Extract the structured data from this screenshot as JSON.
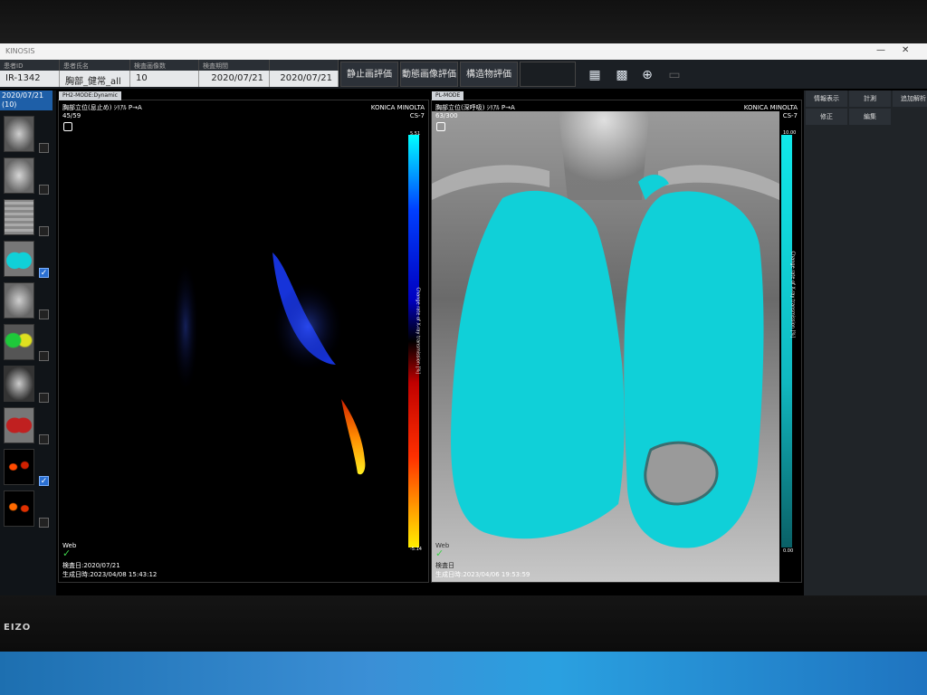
{
  "window": {
    "title": "KINOSIS"
  },
  "header": {
    "fields": [
      {
        "label": "患者ID",
        "value": "IR-1342"
      },
      {
        "label": "患者氏名",
        "value": "胸部_健常_all"
      },
      {
        "label": "検査画像数",
        "value": "10"
      },
      {
        "label": "検査期間",
        "value": "2020/07/21"
      },
      {
        "label": "",
        "value": "2020/07/21"
      }
    ],
    "buttons": [
      "静止画評価",
      "動態画像評価",
      "構造物評価"
    ],
    "icons": [
      "grid-all-icon",
      "grid-settings-icon",
      "zoom-add-icon",
      "film-icon"
    ]
  },
  "thumbnails": {
    "date": "2020/07/21",
    "count": "(10)",
    "items": [
      {
        "type": "xray",
        "checked": false
      },
      {
        "type": "xray",
        "checked": false
      },
      {
        "type": "xray",
        "checked": false
      },
      {
        "type": "cyan-overlay",
        "checked": true
      },
      {
        "type": "xray",
        "checked": false
      },
      {
        "type": "green-overlay",
        "checked": false
      },
      {
        "type": "xray",
        "checked": false
      },
      {
        "type": "red-overlay",
        "checked": false
      },
      {
        "type": "heat-dark",
        "checked": true
      },
      {
        "type": "heat-dark",
        "checked": false
      }
    ]
  },
  "left_viewer": {
    "tab": "PH2-MODE:Dynamic",
    "title": "胸部立位(息止め) ｼﾘｱﾙ P→A",
    "frame": "45/59",
    "maker": "KONICA MINOLTA",
    "model": "CS-7",
    "scale_top": "5.51",
    "scale_bottom": "-5.14",
    "axis_label": "Change rate of X-ray transmission [%]",
    "source": "Web",
    "exam_date": "検査日:2020/07/21",
    "created": "生成日時:2023/04/08 15:43:12",
    "colors": {
      "low": "#ffff00",
      "mid": "#ff0000",
      "high": "#0000ff",
      "top": "#00ffff"
    }
  },
  "right_viewer": {
    "tab": "PL-MODE",
    "title": "胸部立位(深呼吸) ｼﾘｱﾙ P→A",
    "frame": "63/300",
    "maker": "KONICA MINOLTA",
    "model": "CS-7",
    "scale_top": "10.00",
    "scale_bottom": "0.00",
    "axis_label": "Change rate of X-ray transmission [%]",
    "source": "Web",
    "exam_date": "検査日",
    "created": "生成日時:2023/04/06 19:53:59",
    "colors": {
      "lung": "#10d0d8"
    }
  },
  "right_panel": {
    "tabs": [
      "情報表示",
      "計測",
      "追加解析"
    ],
    "buttons": [
      "修正",
      "編集"
    ]
  },
  "monitor": {
    "brand": "EIZO"
  }
}
